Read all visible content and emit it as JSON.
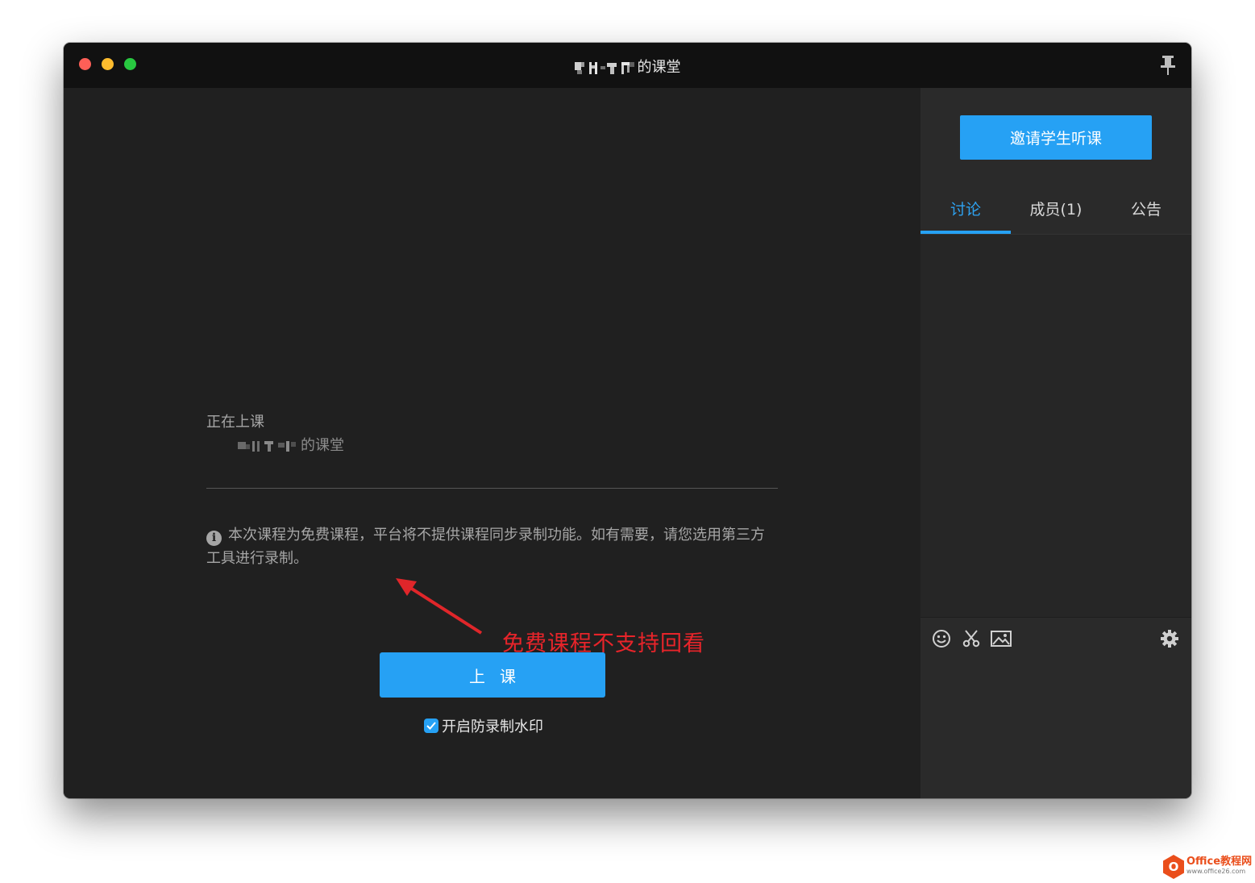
{
  "window": {
    "title": "的课堂"
  },
  "main": {
    "status_label": "正在上课",
    "class_name": "的课堂",
    "notice": "本次课程为免费课程，平台将不提供课程同步录制功能。如有需要，请您选用第三方工具进行录制。",
    "annotation": "免费课程不支持回看",
    "start_button": "上课",
    "watermark_checkbox": {
      "label": "开启防录制水印",
      "checked": true
    }
  },
  "sidebar": {
    "invite_button": "邀请学生听课",
    "tabs": [
      {
        "label": "讨论",
        "active": true
      },
      {
        "label": "成员(1)",
        "active": false
      },
      {
        "label": "公告",
        "active": false
      }
    ],
    "toolbar_icons": [
      "emoji-icon",
      "scissors-icon",
      "image-icon",
      "settings-icon"
    ]
  },
  "footer_logo": {
    "main": "Office教程网",
    "sub": "www.office26.com"
  },
  "colors": {
    "accent": "#26a1f4",
    "annotation": "#e8242a",
    "logo": "#ea4e1b"
  }
}
